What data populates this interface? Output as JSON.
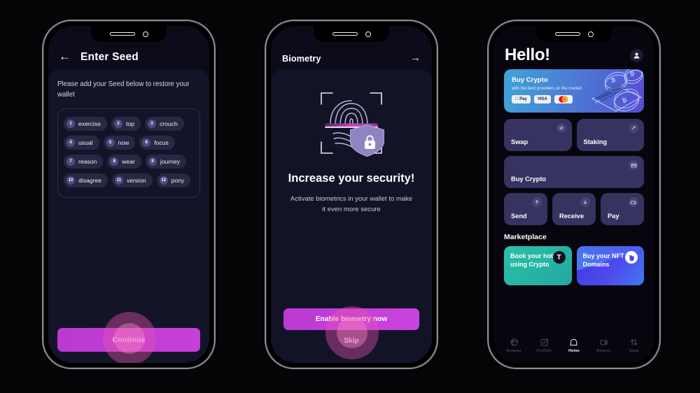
{
  "screens": {
    "seed": {
      "back_icon": "arrow-left-icon",
      "title": "Enter Seed",
      "description": "Please add your Seed below to restore your wallet",
      "words": [
        {
          "n": "1",
          "word": "exercise"
        },
        {
          "n": "2",
          "word": "top"
        },
        {
          "n": "3",
          "word": "crouch"
        },
        {
          "n": "4",
          "word": "usual"
        },
        {
          "n": "5",
          "word": "now"
        },
        {
          "n": "6",
          "word": "focus"
        },
        {
          "n": "7",
          "word": "reason"
        },
        {
          "n": "8",
          "word": "wear"
        },
        {
          "n": "9",
          "word": "journey"
        },
        {
          "n": "10",
          "word": "disagree"
        },
        {
          "n": "11",
          "word": "version"
        },
        {
          "n": "12",
          "word": "pony"
        }
      ],
      "continue_label": "Continue"
    },
    "biometry": {
      "title": "Biometry",
      "forward_icon": "arrow-right-icon",
      "illustration": "fingerprint-scan-shield-lock-icon",
      "heading": "Increase your security!",
      "subtext": "Activate biometrics in your wallet to make it even more secure",
      "enable_label": "Enable biometry now",
      "skip_label": "Skip"
    },
    "home": {
      "greeting": "Hello!",
      "avatar_icon": "user-avatar-icon",
      "banner": {
        "title": "Buy Crypto",
        "subtitle": "with the best providers on the market.",
        "badges": [
          "Pay",
          "VISA",
          "mastercard"
        ]
      },
      "actions": [
        {
          "label": "Swap",
          "icon": "swap-icon"
        },
        {
          "label": "Staking",
          "icon": "staking-icon"
        },
        {
          "label": "Buy Crypto",
          "icon": "card-icon"
        },
        {
          "label": "Send",
          "icon": "arrow-up-icon"
        },
        {
          "label": "Receive",
          "icon": "arrow-down-icon"
        },
        {
          "label": "Pay",
          "icon": "wallet-icon"
        }
      ],
      "marketplace_title": "Marketplace",
      "marketplace": [
        {
          "text": "Book your hotel using Crypto",
          "badge": "T",
          "badge_icon": "travala-logo-icon"
        },
        {
          "text": "Buy your NFT Domains",
          "badge": "U",
          "badge_icon": "unstoppable-domains-logo-icon"
        }
      ],
      "tabs": [
        {
          "label": "Browser",
          "icon": "globe-icon",
          "active": false
        },
        {
          "label": "Portfolio",
          "icon": "chart-icon",
          "active": false
        },
        {
          "label": "Home",
          "icon": "home-icon",
          "active": true
        },
        {
          "label": "Balance",
          "icon": "wallet-icon",
          "active": false
        },
        {
          "label": "Swap",
          "icon": "arrows-up-down-icon",
          "active": false
        }
      ]
    }
  },
  "colors": {
    "background": "#050508",
    "screen_dark": "#0b0b1a",
    "card": "#141428",
    "accent_magenta": "#c13fd6",
    "action_card": "#363360",
    "tap_ripple": "#e856b0"
  }
}
